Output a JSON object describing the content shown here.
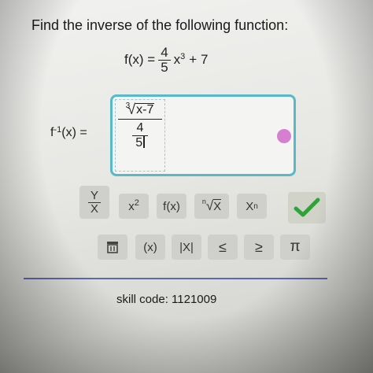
{
  "prompt": "Find the inverse of the following function:",
  "given": {
    "lhs": "f(x) =",
    "coef_num": "4",
    "coef_den": "5",
    "var": "x",
    "exponent": "3",
    "tail": "+ 7"
  },
  "answer": {
    "lhs_f": "f",
    "lhs_exp": "-1",
    "lhs_rest": "(x) =",
    "root_index": "3",
    "radicand": "x-7",
    "den_num": "4",
    "den_den": "5"
  },
  "keypad": {
    "row1": [
      "Y/X fraction",
      "x²",
      "f(x)",
      "ⁿ√x",
      "Xn"
    ],
    "fraction_top": "Y",
    "fraction_bottom": "X",
    "square_base": "x",
    "square_exp": "2",
    "fx": "f(x)",
    "root_n": "n",
    "root_x": "X",
    "sub_base": "X",
    "sub_n": "n",
    "paren": "(x)",
    "abs": "|X|",
    "le": "≤",
    "ge": "≥",
    "pi": "π",
    "submit_color": "#2fa33a"
  },
  "status_dot_color": "#d67fd0",
  "skill_code_label": "skill code:",
  "skill_code": "1121009"
}
